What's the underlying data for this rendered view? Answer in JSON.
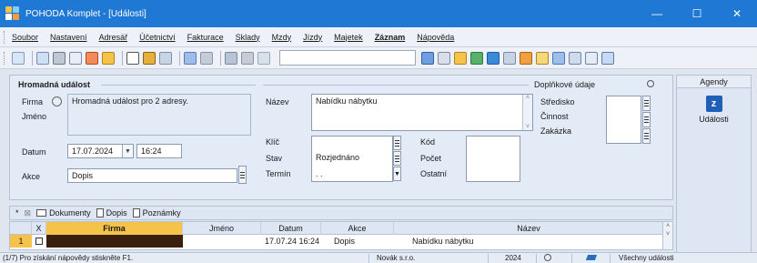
{
  "window": {
    "title": "POHODA Komplet - [Události]",
    "controls": [
      "—",
      "☐",
      "✕"
    ]
  },
  "menu": [
    "Soubor",
    "Nastavení",
    "Adresář",
    "Účetnictví",
    "Fakturace",
    "Sklady",
    "Mzdy",
    "Jízdy",
    "Majetek",
    "Záznam",
    "Nápověda"
  ],
  "form": {
    "section_title": "Hromadná událost",
    "extra_title": "Doplňkové údaje",
    "labels": {
      "firma": "Firma",
      "jmeno": "Jméno",
      "datum": "Datum",
      "akce": "Akce",
      "nazev": "Název",
      "klic": "Klíč",
      "stav": "Stav",
      "termin": "Termín",
      "kod": "Kód",
      "pocet": "Počet",
      "ostatni": "Ostatní",
      "stredisko": "Středisko",
      "cinnost": "Činnost",
      "zakazka": "Zakázka"
    },
    "firma_value": "Hromadná událost pro 2 adresy.",
    "datum_value": "17.07.2024",
    "time_value": "16:24",
    "akce_value": "Dopis",
    "nazev_value": "Nabídku nábytku",
    "stav_value": "Rozjednáno",
    "termin_value": ". ."
  },
  "agenda": {
    "header": "Agendy",
    "item": "Události"
  },
  "tabs": [
    "Dokumenty",
    "Dopis",
    "Poznámky"
  ],
  "grid": {
    "headers": [
      "X",
      "Firma",
      "Jméno",
      "Datum",
      "Akce",
      "Název"
    ],
    "row": {
      "num": "1",
      "datum": "17.07.24 16:24",
      "akce": "Dopis",
      "nazev": "Nabídku nábytku"
    }
  },
  "status": {
    "hint": "(1/7) Pro získání nápovědy stiskněte F1.",
    "company": "Novák s.r.o.",
    "year": "2024",
    "filter": "Všechny události"
  },
  "colors": {
    "titlebar": "#1e78d4",
    "panel": "#e3ecf6",
    "row_marker": "#f5c24a",
    "firma_cell": "#3a1f0f"
  }
}
